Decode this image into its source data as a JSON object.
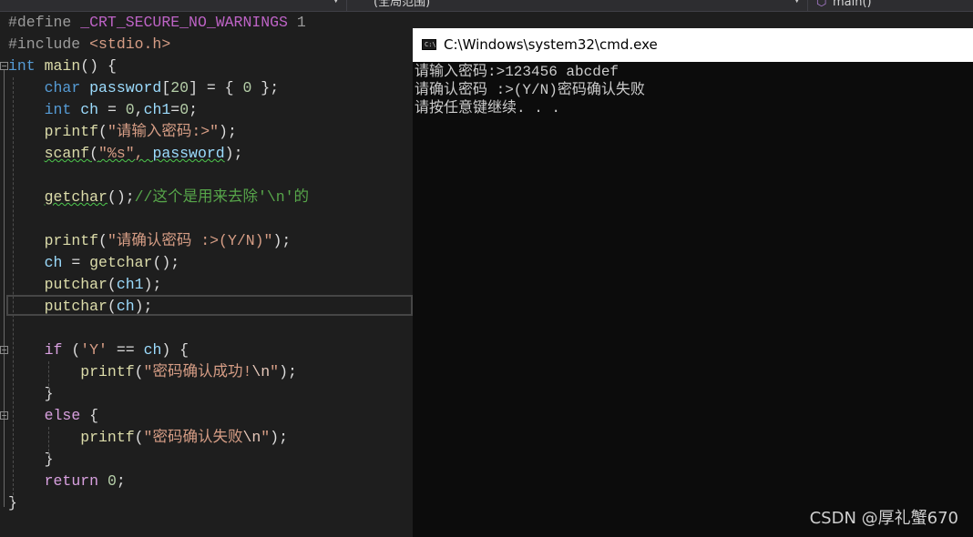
{
  "navbar": {
    "scope_label": "(全局范围)",
    "member_label": "main()"
  },
  "editor": {
    "lines": [
      {
        "tokens": [
          {
            "t": "#define ",
            "c": "pp"
          },
          {
            "t": "_CRT_SECURE_NO_WARNINGS",
            "c": "macro"
          },
          {
            "t": " 1",
            "c": "pp"
          }
        ]
      },
      {
        "tokens": [
          {
            "t": "#include ",
            "c": "pp"
          },
          {
            "t": "<stdio.h>",
            "c": "str"
          }
        ]
      },
      {
        "tokens": [
          {
            "t": "int",
            "c": "kw"
          },
          {
            "t": " main",
            "c": "fn"
          },
          {
            "t": "() {",
            "c": ""
          }
        ]
      },
      {
        "tokens": [
          {
            "t": "    ",
            "c": ""
          },
          {
            "t": "char",
            "c": "kw"
          },
          {
            "t": " password",
            "c": "var"
          },
          {
            "t": "[",
            "c": ""
          },
          {
            "t": "20",
            "c": "num"
          },
          {
            "t": "] = { ",
            "c": ""
          },
          {
            "t": "0",
            "c": "num"
          },
          {
            "t": " };",
            "c": ""
          }
        ]
      },
      {
        "tokens": [
          {
            "t": "    ",
            "c": ""
          },
          {
            "t": "int",
            "c": "kw"
          },
          {
            "t": " ch",
            "c": "var"
          },
          {
            "t": " = ",
            "c": ""
          },
          {
            "t": "0",
            "c": "num"
          },
          {
            "t": ",",
            "c": ""
          },
          {
            "t": "ch1",
            "c": "var"
          },
          {
            "t": "=",
            "c": ""
          },
          {
            "t": "0",
            "c": "num"
          },
          {
            "t": ";",
            "c": ""
          }
        ]
      },
      {
        "tokens": [
          {
            "t": "    ",
            "c": ""
          },
          {
            "t": "printf",
            "c": "fn"
          },
          {
            "t": "(",
            "c": ""
          },
          {
            "t": "\"请输入密码:>\"",
            "c": "str"
          },
          {
            "t": ");",
            "c": ""
          }
        ]
      },
      {
        "tokens": [
          {
            "t": "    ",
            "c": ""
          },
          {
            "t": "scanf",
            "c": "fn squig"
          },
          {
            "t": "(",
            "c": "squig"
          },
          {
            "t": "\"%s\", ",
            "c": "str squig"
          },
          {
            "t": "password",
            "c": "var squig"
          },
          {
            "t": ");",
            "c": ""
          }
        ]
      },
      {
        "tokens": []
      },
      {
        "tokens": [
          {
            "t": "    ",
            "c": ""
          },
          {
            "t": "getchar",
            "c": "fn squig"
          },
          {
            "t": "();",
            "c": ""
          },
          {
            "t": "//这个是用来去除'\\n'的",
            "c": "cmt"
          }
        ]
      },
      {
        "tokens": []
      },
      {
        "tokens": [
          {
            "t": "    ",
            "c": ""
          },
          {
            "t": "printf",
            "c": "fn"
          },
          {
            "t": "(",
            "c": ""
          },
          {
            "t": "\"请确认密码 :>(Y/N)\"",
            "c": "str"
          },
          {
            "t": ");",
            "c": ""
          }
        ]
      },
      {
        "tokens": [
          {
            "t": "    ",
            "c": ""
          },
          {
            "t": "ch",
            "c": "var"
          },
          {
            "t": " = ",
            "c": ""
          },
          {
            "t": "getchar",
            "c": "fn"
          },
          {
            "t": "();",
            "c": ""
          }
        ]
      },
      {
        "tokens": [
          {
            "t": "    ",
            "c": ""
          },
          {
            "t": "putchar",
            "c": "fn"
          },
          {
            "t": "(",
            "c": ""
          },
          {
            "t": "ch1",
            "c": "var"
          },
          {
            "t": ");",
            "c": ""
          }
        ]
      },
      {
        "tokens": [
          {
            "t": "    ",
            "c": ""
          },
          {
            "t": "putchar",
            "c": "fn"
          },
          {
            "t": "(",
            "c": ""
          },
          {
            "t": "ch",
            "c": "var"
          },
          {
            "t": ");",
            "c": ""
          }
        ]
      },
      {
        "tokens": []
      },
      {
        "tokens": [
          {
            "t": "    ",
            "c": ""
          },
          {
            "t": "if",
            "c": "kw2"
          },
          {
            "t": " (",
            "c": ""
          },
          {
            "t": "'Y'",
            "c": "str"
          },
          {
            "t": " == ",
            "c": ""
          },
          {
            "t": "ch",
            "c": "var"
          },
          {
            "t": ") {",
            "c": ""
          }
        ]
      },
      {
        "tokens": [
          {
            "t": "        ",
            "c": ""
          },
          {
            "t": "printf",
            "c": "fn"
          },
          {
            "t": "(",
            "c": ""
          },
          {
            "t": "\"密码确认成功!",
            "c": "str"
          },
          {
            "t": "\\n",
            "c": "esc"
          },
          {
            "t": "\"",
            "c": "str"
          },
          {
            "t": ");",
            "c": ""
          }
        ]
      },
      {
        "tokens": [
          {
            "t": "    }",
            "c": ""
          }
        ]
      },
      {
        "tokens": [
          {
            "t": "    ",
            "c": ""
          },
          {
            "t": "else",
            "c": "kw2"
          },
          {
            "t": " {",
            "c": ""
          }
        ]
      },
      {
        "tokens": [
          {
            "t": "        ",
            "c": ""
          },
          {
            "t": "printf",
            "c": "fn"
          },
          {
            "t": "(",
            "c": ""
          },
          {
            "t": "\"密码确认失败",
            "c": "str"
          },
          {
            "t": "\\n",
            "c": "esc"
          },
          {
            "t": "\"",
            "c": "str"
          },
          {
            "t": ");",
            "c": ""
          }
        ]
      },
      {
        "tokens": [
          {
            "t": "    }",
            "c": ""
          }
        ]
      },
      {
        "tokens": [
          {
            "t": "    ",
            "c": ""
          },
          {
            "t": "return",
            "c": "kw2"
          },
          {
            "t": " ",
            "c": ""
          },
          {
            "t": "0",
            "c": "num"
          },
          {
            "t": ";",
            "c": ""
          }
        ]
      },
      {
        "tokens": [
          {
            "t": "}",
            "c": ""
          }
        ]
      }
    ]
  },
  "console": {
    "title": "C:\\Windows\\system32\\cmd.exe",
    "icon_text": "C:\\",
    "output": [
      "请输入密码:>123456 abcdef",
      "请确认密码 :>(Y/N)密码确认失败",
      "请按任意键继续. . ."
    ]
  },
  "watermark": "CSDN @厚礼蟹670",
  "colors": {
    "editor_bg": "#1e1e1e",
    "console_bg": "#0c0c0c",
    "keyword": "#569cd6",
    "control_keyword": "#d8a0df",
    "function": "#dcdcaa",
    "variable": "#9cdcfe",
    "string": "#d69d85",
    "comment": "#57a64a"
  }
}
